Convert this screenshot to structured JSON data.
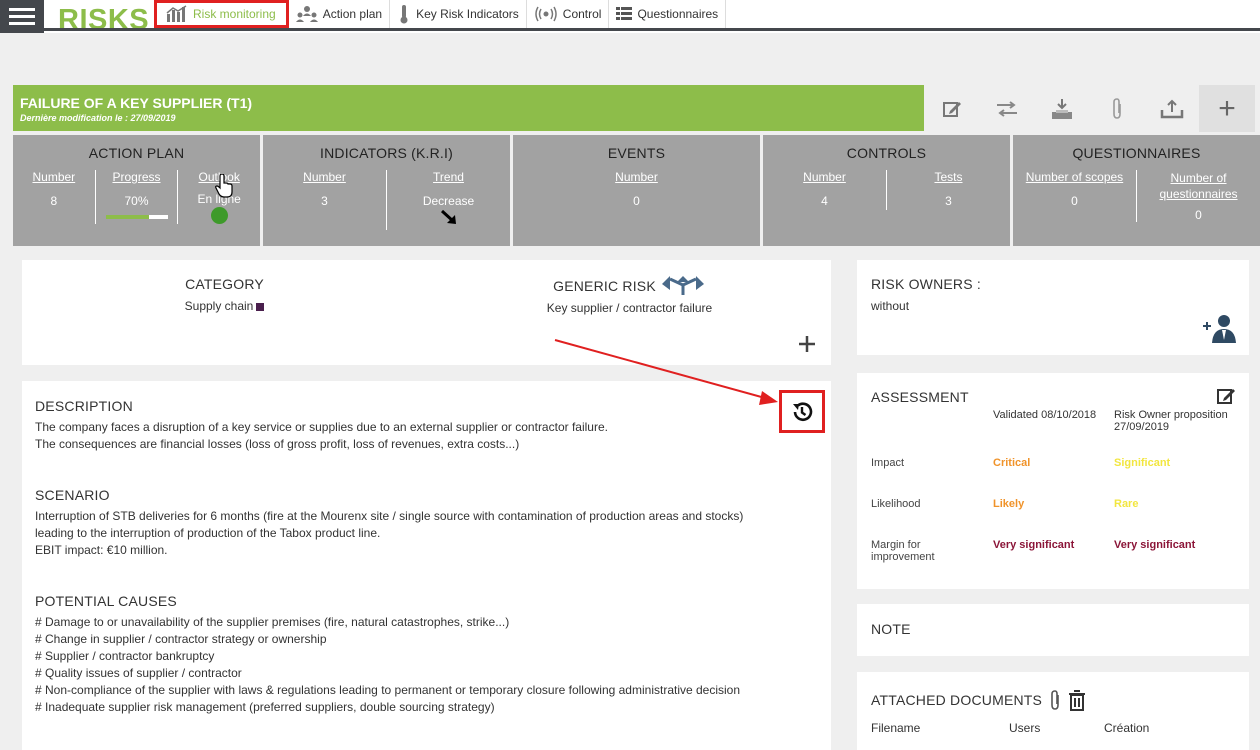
{
  "app": {
    "title": "RISKS"
  },
  "tabs": [
    {
      "label": "Risk monitoring"
    },
    {
      "label": "Action plan"
    },
    {
      "label": "Key Risk Indicators"
    },
    {
      "label": "Control"
    },
    {
      "label": "Questionnaires"
    }
  ],
  "risk": {
    "title": "FAILURE OF A KEY SUPPLIER (T1)",
    "last_modified": "Dernière modification le : 27/09/2019"
  },
  "toolbar": {
    "add_label": "+"
  },
  "stats": {
    "action_plan": {
      "heading": "ACTION PLAN",
      "number_label": "Number",
      "number_value": "8",
      "progress_label": "Progress",
      "progress_value": "70%",
      "progress_fraction": 0.7,
      "outlook_label": "Outlook",
      "outlook_value": "En ligne",
      "outlook_color": "#3e9a2a"
    },
    "indicators": {
      "heading": "INDICATORS (K.R.I)",
      "number_label": "Number",
      "number_value": "3",
      "trend_label": "Trend",
      "trend_value": "Decrease"
    },
    "events": {
      "heading": "EVENTS",
      "number_label": "Number",
      "number_value": "0"
    },
    "controls": {
      "heading": "CONTROLS",
      "number_label": "Number",
      "number_value": "4",
      "tests_label": "Tests",
      "tests_value": "3"
    },
    "questionnaires": {
      "heading": "QUESTIONNAIRES",
      "scopes_label": "Number of scopes",
      "scopes_value": "0",
      "questionnaires_label": "Number of questionnaires",
      "questionnaires_value": "0"
    }
  },
  "category": {
    "heading": "CATEGORY",
    "value": "Supply chain",
    "swatch_color": "#4a1f4d"
  },
  "generic_risk": {
    "heading": "GENERIC RISK",
    "value": "Key supplier / contractor failure"
  },
  "description": {
    "heading": "DESCRIPTION",
    "lines": [
      "The company faces a disruption of a key service or supplies due to an external supplier or contractor failure.",
      "The consequences are financial losses (loss of gross profit, loss of revenues, extra costs...)"
    ]
  },
  "scenario": {
    "heading": "SCENARIO",
    "lines": [
      "Interruption of STB deliveries for 6 months (fire at the Mourenx site / single source with contamination of production areas and stocks)",
      "leading to the interruption of production of the Tabox product line.",
      "EBIT impact: €10 million."
    ]
  },
  "causes": {
    "heading": "POTENTIAL CAUSES",
    "lines": [
      "# Damage to or unavailability of the supplier premises (fire, natural catastrophes, strike...)",
      "# Change in supplier / contractor strategy or ownership",
      "# Supplier / contractor bankruptcy",
      "# Quality issues of supplier / contractor",
      "# Non-compliance of the supplier with laws & regulations leading to permanent or temporary closure following administrative decision",
      "# Inadequate supplier risk management (preferred suppliers, double sourcing strategy)"
    ]
  },
  "owners": {
    "heading": "RISK OWNERS :",
    "value": "without"
  },
  "assessment": {
    "heading": "ASSESSMENT",
    "col_validated": "Validated 08/10/2018",
    "col_proposal": "Risk Owner proposition 27/09/2019",
    "rows": [
      {
        "label": "Impact",
        "validated": "Critical",
        "proposal": "Significant"
      },
      {
        "label": "Likelihood",
        "validated": "Likely",
        "proposal": "Rare"
      },
      {
        "label": "Margin for improvement",
        "validated": "Very significant",
        "proposal": "Very significant"
      }
    ],
    "colors": {
      "critical": "#f0932a",
      "significant": "#f2e640",
      "very_significant": "#8b1538"
    }
  },
  "note": {
    "heading": "NOTE"
  },
  "documents": {
    "heading": "ATTACHED DOCUMENTS",
    "columns": [
      "Filename",
      "Users",
      "Création"
    ]
  },
  "accent_color": "#8dbd4a"
}
